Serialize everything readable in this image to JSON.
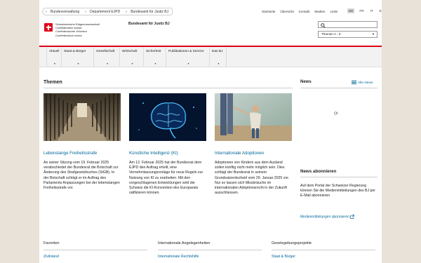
{
  "breadcrumbs": [
    "Bundesverwaltung",
    "Departement EJPD",
    "Bundesamt für Justiz BJ"
  ],
  "utility_links": [
    "Startseite",
    "Übersicht",
    "Kontakt",
    "Medien",
    "Links"
  ],
  "languages": [
    "DE",
    "FR",
    "IT",
    "EN"
  ],
  "active_language": "DE",
  "confederation": {
    "lines": [
      "Schweizerische Eidgenossenschaft",
      "Confédération suisse",
      "Confederazione Svizzera",
      "Confederaziun svizra"
    ]
  },
  "agency": "Bundesamt für Justiz BJ",
  "search": {
    "placeholder": ""
  },
  "topic_select": {
    "value": "Themen A - Z"
  },
  "nav": [
    {
      "label": "Aktuell"
    },
    {
      "label": "Staat & Bürger"
    },
    {
      "label": "Gesellschaft"
    },
    {
      "label": "Wirtschaft"
    },
    {
      "label": "Sicherheit"
    },
    {
      "label": "Publikationen & Service"
    },
    {
      "label": "Das BJ"
    }
  ],
  "themen": {
    "heading": "Themen",
    "cards": [
      {
        "title": "Lebenslange Freiheitsstrafe",
        "text": "An seiner Sitzung vom 19. Februar 2025 verabschiedet der Bundesrat die Botschaft zur Änderung des Strafgesetzbuches (StGB). In der Botschaft schlägt er im Auftrag des Parlaments Anpassungen bei der lebenslangen Freiheitsstrafe vor."
      },
      {
        "title": "Künstliche Intelligenz (KI)",
        "text": "Am 12. Februar 2025 hat der Bundesrat dem EJPD den Auftrag erteilt, eine Vernehmlassungsvorlage für neue Regeln zur Nutzung von KI zu erarbeiten. Mit den vorgeschlagenen Entwicklungen wird die Schweiz die KI-Konvention des Europarats ratifizieren können."
      },
      {
        "title": "Internationale Adoptionen",
        "text": "Adoptionen von Kindern aus dem Ausland sollen künftig nicht mehr möglich sein. Dies schlägt der Bundesrat in seinem Grundsatzentscheid vom 29. Januar 2025 vor. Nur so lassen sich Missbräuche im internationalen Adoptionsrecht in der Zukunft ausschliessen."
      }
    ]
  },
  "news": {
    "heading": "News",
    "all_label": "Alle News"
  },
  "subscribe": {
    "heading": "News abonnieren",
    "text": "Auf dem Portal der Schweizer Regierung können Sie die Medienmitteilungen des BJ per E-Mail abonnieren",
    "link": "Medienmitteilungen abonnieren"
  },
  "footer": [
    {
      "heading": "Favoriten",
      "first_link": "Zivilstand"
    },
    {
      "heading": "Internationale Angelegenheiten",
      "first_link": "Internationale Rechtshilfe"
    },
    {
      "heading": "Gesetzgebungsprojekte",
      "first_link": "Staat & Bürger"
    }
  ],
  "colors": {
    "brand_red": "#dc0018",
    "link_blue": "#006699",
    "background": "#e9e2d8"
  }
}
